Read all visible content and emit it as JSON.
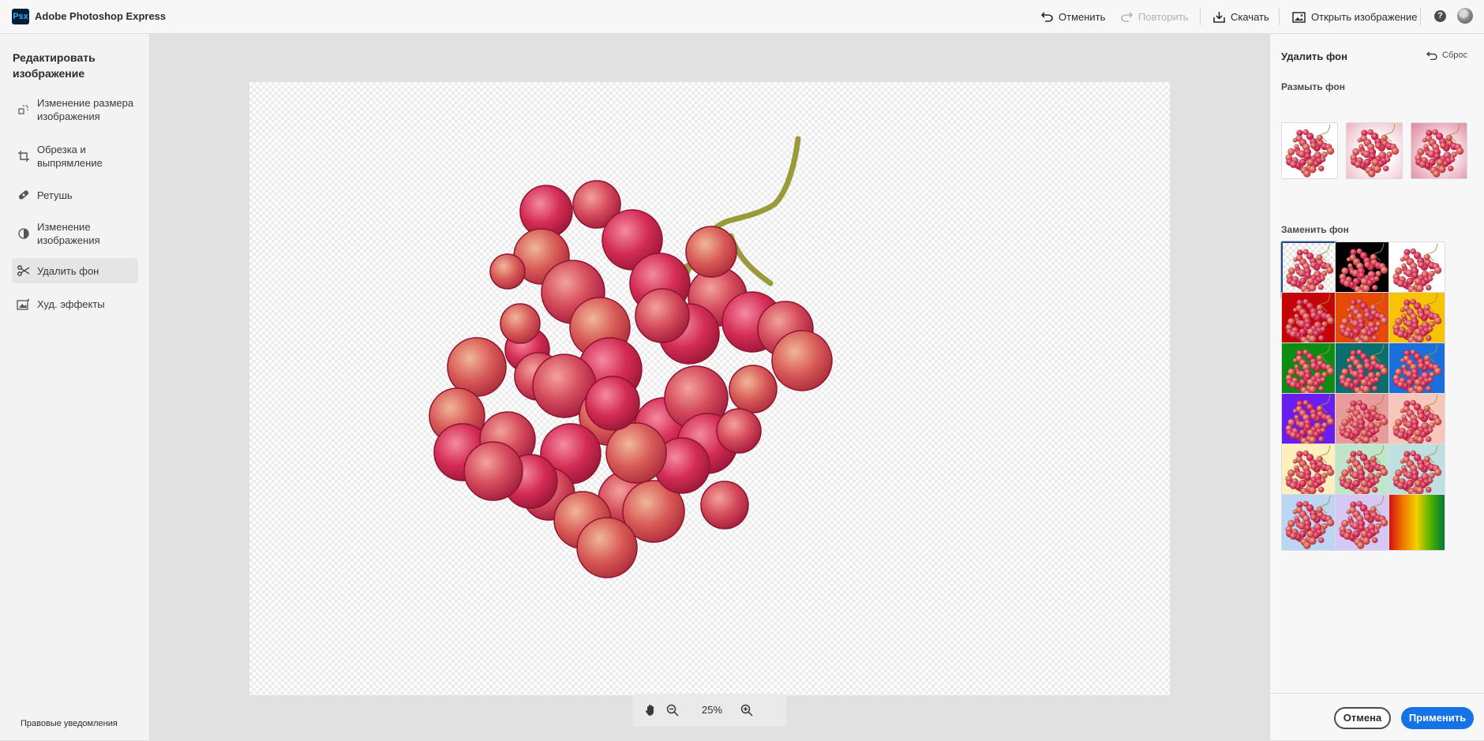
{
  "app": {
    "logo_text": "Psx",
    "title": "Adobe Photoshop Express"
  },
  "toolbar": {
    "undo_label": "Отменить",
    "redo_label": "Повторить",
    "download_label": "Скачать",
    "open_image_label": "Открыть изображение",
    "help_icon": "?"
  },
  "sidebar": {
    "title": "Редактировать изображение",
    "items": [
      {
        "label": "Изменение размера изображения",
        "icon": "resize-icon",
        "active": false
      },
      {
        "label": "Обрезка и выпрямление",
        "icon": "crop-icon",
        "active": false
      },
      {
        "label": "Ретушь",
        "icon": "bandage-icon",
        "active": false
      },
      {
        "label": "Изменение изображения",
        "icon": "adjust-icon",
        "active": false
      },
      {
        "label": "Удалить фон",
        "icon": "scissors-icon",
        "active": true
      },
      {
        "label": "Худ. эффекты",
        "icon": "effects-icon",
        "active": false
      }
    ],
    "legal_label": "Правовые уведомления"
  },
  "canvas": {
    "zoom_label": "25%",
    "tools": [
      "hand-icon",
      "zoom-out-icon",
      "zoom-in-icon"
    ]
  },
  "panel": {
    "title": "Удалить фон",
    "reset_label": "Сброс",
    "blur_section_title": "Размыть фон",
    "replace_section_title": "Заменить фон",
    "blur_options": [
      "none",
      "light",
      "strong"
    ],
    "backgrounds": [
      {
        "name": "transparent",
        "color": "transparent"
      },
      {
        "name": "black",
        "color": "#000000"
      },
      {
        "name": "white",
        "color": "#ffffff"
      },
      {
        "name": "red",
        "color": "#c50408"
      },
      {
        "name": "orange",
        "color": "#e64a05"
      },
      {
        "name": "yellow",
        "color": "#f9c202"
      },
      {
        "name": "green",
        "color": "#0d8c14"
      },
      {
        "name": "teal",
        "color": "#0a6e6e"
      },
      {
        "name": "blue",
        "color": "#1a6fdc"
      },
      {
        "name": "violet",
        "color": "#6a1df0"
      },
      {
        "name": "pink",
        "color": "#e89b9b"
      },
      {
        "name": "peach",
        "color": "#f7c7bb"
      },
      {
        "name": "cream",
        "color": "#fdf0be"
      },
      {
        "name": "mint",
        "color": "#bfe5cb"
      },
      {
        "name": "aqua",
        "color": "#bfe0e0"
      },
      {
        "name": "light-blue",
        "color": "#bcd5f2"
      },
      {
        "name": "lavender",
        "color": "#d5c8f5"
      },
      {
        "name": "rainbow",
        "color": "gradient"
      }
    ],
    "cancel_label": "Отмена",
    "apply_label": "Применить"
  },
  "colors": {
    "accent": "#1473e6",
    "grape": "#c8284b"
  }
}
